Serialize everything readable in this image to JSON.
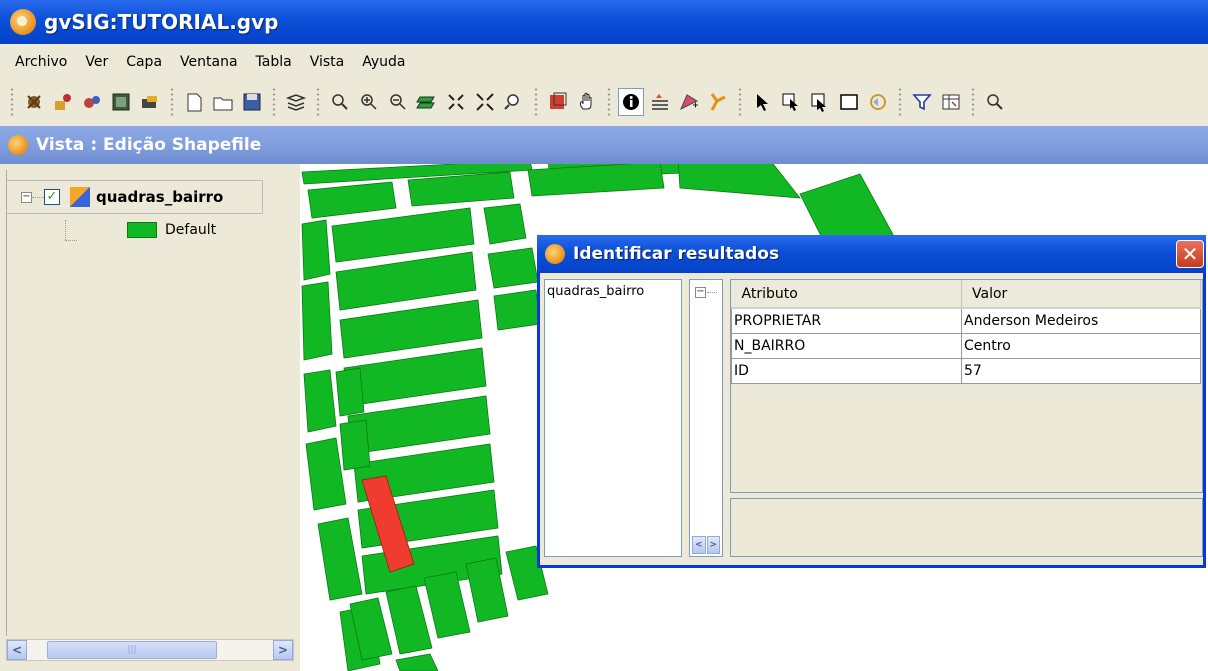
{
  "window": {
    "title": "gvSIG:TUTORIAL.gvp"
  },
  "menu": [
    "Archivo",
    "Ver",
    "Capa",
    "Ventana",
    "Tabla",
    "Vista",
    "Ayuda"
  ],
  "view": {
    "title": "Vista : Edição Shapefile"
  },
  "toc": {
    "layer_name": "quadras_bairro",
    "layer_checked": true,
    "legend_label": "Default",
    "legend_color": "#12B823"
  },
  "map": {
    "block_color": "#12B823",
    "selected_color": "#F03C2E",
    "street_color": "#FFFFFF"
  },
  "identify_dialog": {
    "title": "Identificar resultados",
    "layers": [
      "quadras_bairro"
    ],
    "columns": [
      "Atributo",
      "Valor"
    ],
    "rows": [
      {
        "attribute": "PROPRIETAR",
        "value": "Anderson Medeiros"
      },
      {
        "attribute": "N_BAIRRO",
        "value": "Centro"
      },
      {
        "attribute": "ID",
        "value": "57"
      }
    ]
  }
}
